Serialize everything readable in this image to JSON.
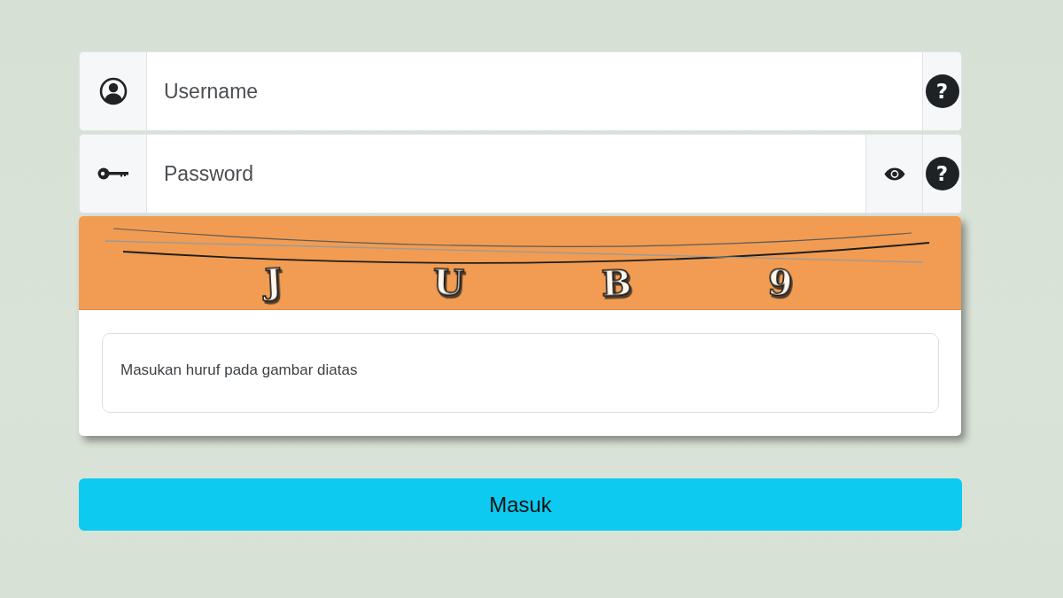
{
  "fields": [
    {
      "kind": "username",
      "placeholder": "Username",
      "help": "?"
    },
    {
      "kind": "password",
      "placeholder": "Password",
      "help": "?"
    }
  ],
  "captcha": {
    "characters": [
      "J",
      "U",
      "B",
      "9"
    ],
    "answer_field": {
      "placeholder": "Masukan huruf pada gambar diatas"
    }
  },
  "submit_button": {
    "label": "Masuk"
  }
}
